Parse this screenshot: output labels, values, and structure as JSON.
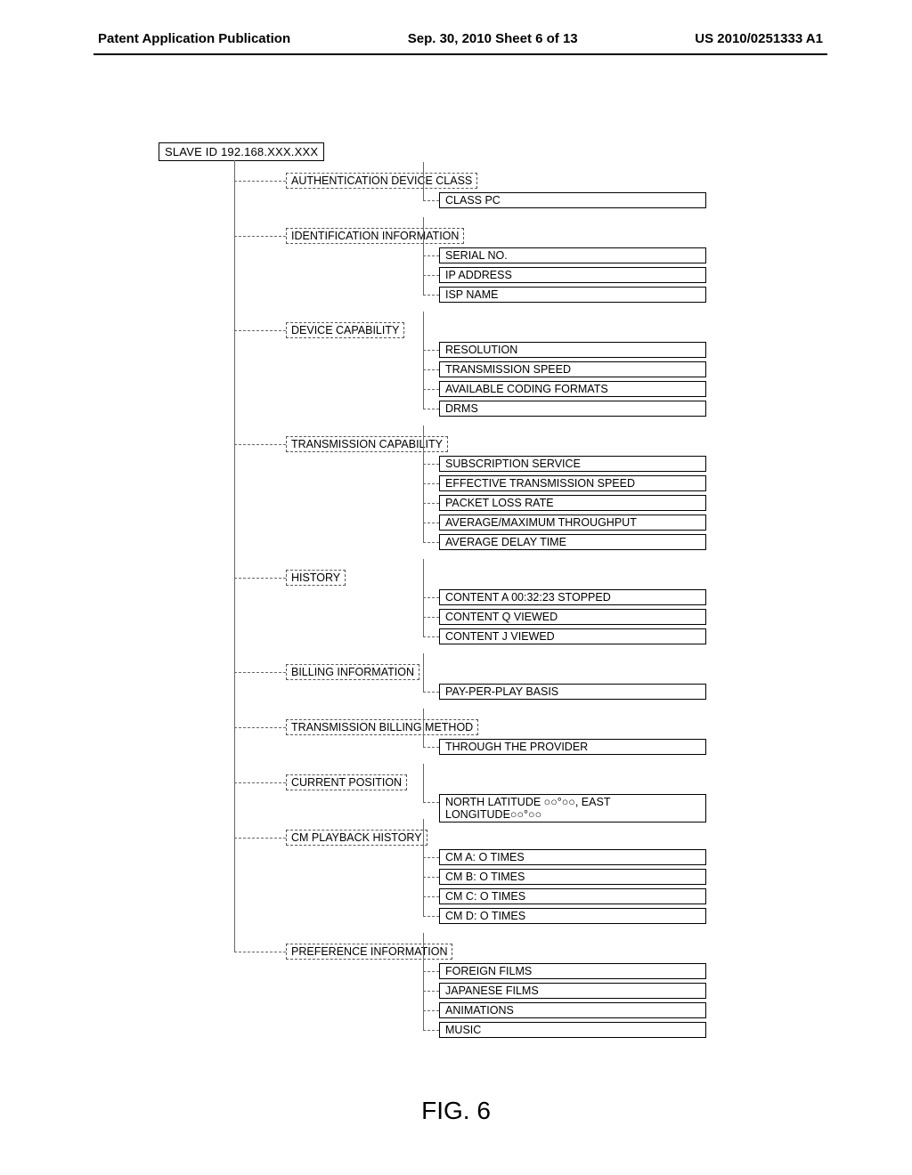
{
  "header": {
    "left": "Patent Application Publication",
    "center": "Sep. 30, 2010  Sheet 6 of 13",
    "right": "US 2010/0251333 A1"
  },
  "root": "SLAVE ID 192.168.XXX.XXX",
  "sections": [
    {
      "label": "AUTHENTICATION DEVICE CLASS",
      "items": [
        "CLASS PC"
      ]
    },
    {
      "label": "IDENTIFICATION INFORMATION",
      "items": [
        "SERIAL NO.",
        "IP ADDRESS",
        "ISP NAME"
      ]
    },
    {
      "label": "DEVICE CAPABILITY",
      "items": [
        "RESOLUTION",
        "TRANSMISSION SPEED",
        "AVAILABLE CODING FORMATS",
        "DRMS"
      ]
    },
    {
      "label": "TRANSMISSION CAPABILITY",
      "items": [
        "SUBSCRIPTION SERVICE",
        "EFFECTIVE TRANSMISSION SPEED",
        "PACKET LOSS RATE",
        "AVERAGE/MAXIMUM THROUGHPUT",
        "AVERAGE DELAY TIME"
      ]
    },
    {
      "label": "HISTORY",
      "items": [
        "CONTENT A  00:32:23  STOPPED",
        "CONTENT Q  VIEWED",
        "CONTENT J  VIEWED"
      ]
    },
    {
      "label": "BILLING INFORMATION",
      "items": [
        "PAY-PER-PLAY BASIS"
      ]
    },
    {
      "label": "TRANSMISSION BILLING METHOD",
      "items": [
        "THROUGH THE PROVIDER"
      ]
    },
    {
      "label": "CURRENT POSITION",
      "items": [
        "NORTH LATITUDE ○○°○○, EAST LONGITUDE○○°○○"
      ]
    },
    {
      "label": "CM PLAYBACK HISTORY",
      "items": [
        "CM A: O TIMES",
        "CM B: O TIMES",
        "CM C: O TIMES",
        "CM D: O TIMES"
      ]
    },
    {
      "label": "PREFERENCE INFORMATION",
      "items": [
        "FOREIGN FILMS",
        "JAPANESE FILMS",
        "ANIMATIONS",
        "MUSIC"
      ]
    }
  ],
  "figure_label": "FIG. 6"
}
